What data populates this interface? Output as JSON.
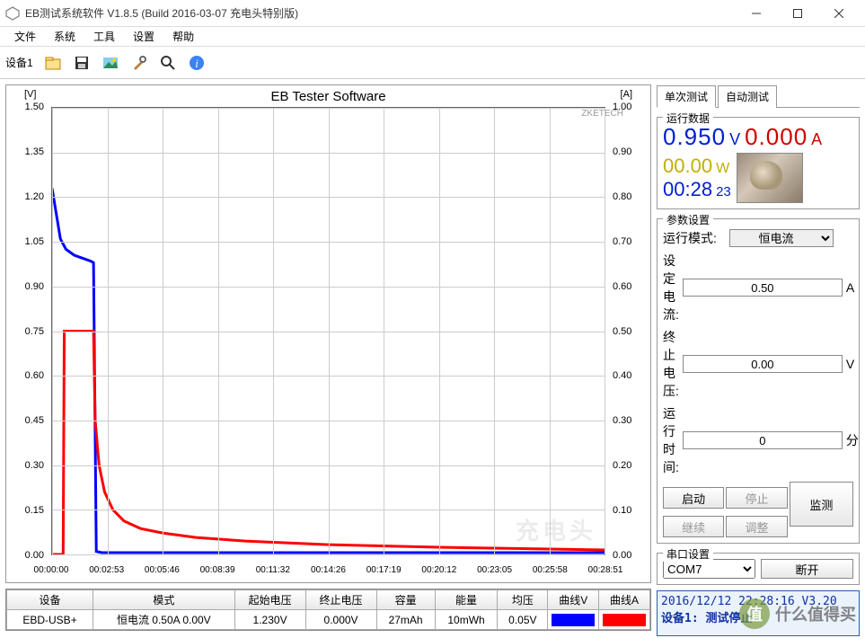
{
  "window": {
    "title": "EB测试系统软件 V1.8.5 (Build 2016-03-07 充电头特别版)"
  },
  "menu": [
    "文件",
    "系统",
    "工具",
    "设置",
    "帮助"
  ],
  "toolbar": {
    "device_tab": "设备1"
  },
  "chart_data": {
    "type": "line",
    "title": "EB Tester Software",
    "brand": "ZKETECH",
    "y_left_label": "[V]",
    "y_right_label": "[A]",
    "y_left_ticks": [
      "0.00",
      "0.15",
      "0.30",
      "0.45",
      "0.60",
      "0.75",
      "0.90",
      "1.05",
      "1.20",
      "1.35",
      "1.50"
    ],
    "y_right_ticks": [
      "0.00",
      "0.10",
      "0.20",
      "0.30",
      "0.40",
      "0.50",
      "0.60",
      "0.70",
      "0.80",
      "0.90",
      "1.00"
    ],
    "x_ticks": [
      "00:00:00",
      "00:02:53",
      "00:05:46",
      "00:08:39",
      "00:11:32",
      "00:14:26",
      "00:17:19",
      "00:20:12",
      "00:23:05",
      "00:25:58",
      "00:28:51"
    ],
    "y_left_range": [
      0,
      1.5
    ],
    "y_right_range": [
      0,
      1.0
    ],
    "series": [
      {
        "name": "曲线V",
        "axis": "left",
        "color": "#0000ff",
        "x_frac": [
          0.0,
          0.015,
          0.025,
          0.04,
          0.055,
          0.07,
          0.075,
          0.08,
          0.085,
          0.09,
          0.095,
          0.1,
          0.11,
          0.13,
          0.16,
          0.2,
          0.26,
          0.35,
          0.5,
          0.7,
          0.85,
          1.0
        ],
        "y": [
          1.23,
          1.06,
          1.025,
          1.005,
          0.995,
          0.985,
          0.98,
          0.01,
          0.008,
          0.006,
          0.006,
          0.006,
          0.006,
          0.006,
          0.006,
          0.006,
          0.006,
          0.006,
          0.006,
          0.006,
          0.006,
          0.006
        ]
      },
      {
        "name": "曲线A",
        "axis": "right",
        "color": "#ff0000",
        "x_frac": [
          0.0,
          0.02,
          0.022,
          0.075,
          0.078,
          0.085,
          0.095,
          0.11,
          0.13,
          0.16,
          0.2,
          0.26,
          0.35,
          0.5,
          0.7,
          0.85,
          1.0
        ],
        "y": [
          0.0,
          0.0,
          0.5,
          0.5,
          0.3,
          0.2,
          0.14,
          0.1,
          0.075,
          0.058,
          0.048,
          0.038,
          0.03,
          0.022,
          0.016,
          0.013,
          0.01
        ]
      }
    ]
  },
  "table": {
    "headers": [
      "设备",
      "模式",
      "起始电压",
      "终止电压",
      "容量",
      "能量",
      "均压",
      "曲线V",
      "曲线A"
    ],
    "row": {
      "device": "EBD-USB+",
      "mode": "恒电流   0.50A  0.00V",
      "vstart": "1.230V",
      "vend": "0.000V",
      "capacity": "27mAh",
      "energy": "10mWh",
      "avgv": "0.05V"
    }
  },
  "tabs": {
    "single": "单次测试",
    "auto": "自动测试"
  },
  "run_group": {
    "title": "运行数据",
    "voltage": "0.950",
    "voltage_unit": "V",
    "current": "0.000",
    "current_unit": "A",
    "power": "00.00",
    "power_unit": "W",
    "time": "00:28",
    "time_sec": "23"
  },
  "param_group": {
    "title": "参数设置",
    "mode_label": "运行模式:",
    "mode_value": "恒电流",
    "setcur_label": "设定电流:",
    "setcur_value": "0.50",
    "setcur_unit": "A",
    "stopv_label": "终止电压:",
    "stopv_value": "0.00",
    "stopv_unit": "V",
    "runtime_label": "运行时间:",
    "runtime_value": "0",
    "runtime_unit": "分",
    "btn_start": "启动",
    "btn_stop": "停止",
    "btn_monitor": "监测",
    "btn_continue": "继续",
    "btn_adjust": "调整"
  },
  "serial_group": {
    "title": "串口设置",
    "port": "COM7",
    "disconnect": "断开"
  },
  "log": {
    "line1": "2016/12/12 22:28:16  V3.20",
    "line2": "设备1: 测试停止"
  },
  "watermark": {
    "badge": "值",
    "text": "什么值得买"
  },
  "chart_wm": "充电头"
}
